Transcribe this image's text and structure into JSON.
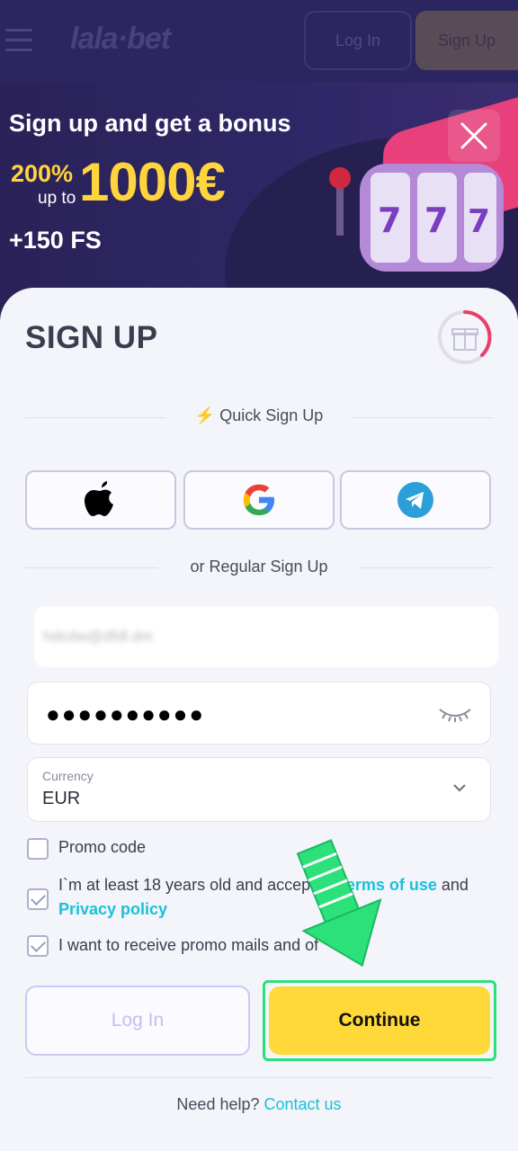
{
  "header": {
    "logo": "lala·bet",
    "login_label": "Log In",
    "signup_label": "Sign Up"
  },
  "banner": {
    "title": "Sign up and get a bonus",
    "percent": "200%",
    "up_to": "up to",
    "amount": "1000€",
    "free_spins": "+150 FS"
  },
  "form": {
    "title": "SIGN UP",
    "quick_signup": "Quick Sign Up",
    "regular_signup": "or Regular Sign Up",
    "email_value": "hdcdw@dfdl.dm",
    "password_value": "●●●●●●●●●●",
    "currency_label": "Currency",
    "currency_value": "EUR",
    "promo_code_label": "Promo code",
    "age_text_before": "I`m at least 18 years old and accept th",
    "terms_link": "Terms of use",
    "and_text": "and",
    "privacy_link": "Privacy policy",
    "promo_mails_text": "I want to receive promo mails and of",
    "login_button": "Log In",
    "continue_button": "Continue",
    "help_text": "Need help?",
    "contact_link": "Contact us"
  },
  "colors": {
    "accent_yellow": "#ffd93a",
    "link_cyan": "#18c2d8",
    "highlight_green": "#2ce07a",
    "banner_bg": "#2c2660"
  }
}
